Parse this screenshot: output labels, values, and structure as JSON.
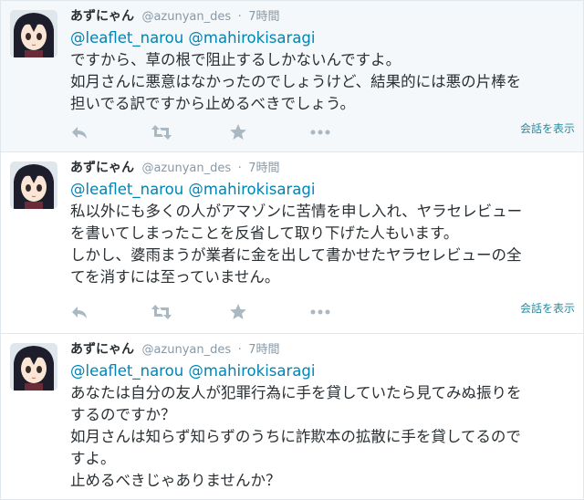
{
  "tweets": [
    {
      "name": "あずにゃん",
      "handle": "@azunyan_des",
      "separator": "·",
      "time": "7時間",
      "mentions": [
        "@leaflet_narou",
        "@mahirokisaragi"
      ],
      "lines": [
        "ですから、草の根で阻止するしかないんですよ。",
        "如月さんに悪意はなかったのでしょうけど、結果的には悪の片棒を",
        "担いでる訳ですから止めるべきでしょう。"
      ],
      "conversation_link": "会話を表示"
    },
    {
      "name": "あずにゃん",
      "handle": "@azunyan_des",
      "separator": "·",
      "time": "7時間",
      "mentions": [
        "@leaflet_narou",
        "@mahirokisaragi"
      ],
      "lines": [
        "私以外にも多くの人がアマゾンに苦情を申し入れ、ヤラセレビュー",
        "を書いてしまったことを反省して取り下げた人もいます。",
        "しかし、婆雨まうが業者に金を出して書かせたヤラセレビューの全",
        "てを消すには至っていません。"
      ],
      "conversation_link": "会話を表示"
    },
    {
      "name": "あずにゃん",
      "handle": "@azunyan_des",
      "separator": "·",
      "time": "7時間",
      "mentions": [
        "@leaflet_narou",
        "@mahirokisaragi"
      ],
      "lines": [
        "あなたは自分の友人が犯罪行為に手を貸していたら見てみぬ振りを",
        "するのですか？",
        "如月さんは知らず知らずのうちに詐欺本の拡散に手を貸してるので",
        "すよ。",
        "止めるべきじゃありませんか？"
      ]
    }
  ],
  "icons": {
    "reply": "reply-icon",
    "retweet": "retweet-icon",
    "favorite": "star-icon",
    "more": "more-icon"
  },
  "colors": {
    "mention": "#0084b4",
    "muted": "#8899a6",
    "highlight_bg": "#f5f8fa",
    "action_icon": "#aab8c2"
  }
}
